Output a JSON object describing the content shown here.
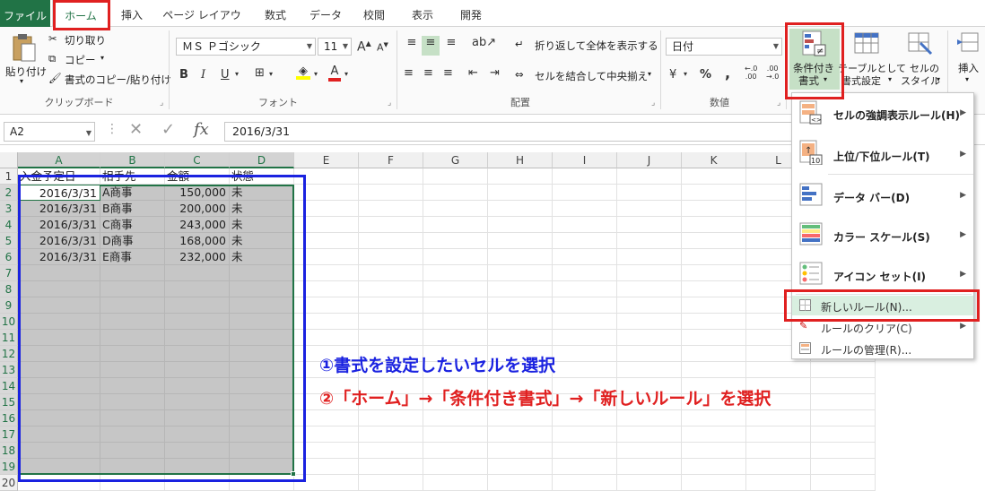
{
  "tabs": [
    "ファイル",
    "ホーム",
    "挿入",
    "ページ レイアウト",
    "数式",
    "データ",
    "校閲",
    "表示",
    "開発"
  ],
  "clipboard": {
    "paste": "貼り付け",
    "cut": "切り取り",
    "copy": "コピー",
    "format_painter": "書式のコピー/貼り付け",
    "group": "クリップボード"
  },
  "font": {
    "name": "ＭＳ Ｐゴシック",
    "size": "11",
    "grow": "A",
    "shrink": "A",
    "bold": "B",
    "italic": "I",
    "underline": "U",
    "color_a": "A",
    "group": "フォント"
  },
  "alignment": {
    "wrap": "折り返して全体を表示する",
    "merge": "セルを結合して中央揃え",
    "group": "配置"
  },
  "number": {
    "format": "日付",
    "currency": "¥",
    "percent": "%",
    "comma": ",",
    "inc_decimal": "←.0\n.00",
    "dec_decimal": ".00\n→.0",
    "group": "数値"
  },
  "styles": {
    "conditional": "条件付き\n書式",
    "conditional_line1": "条件付き",
    "conditional_line2": "書式",
    "table_line1": "テーブルとして",
    "table_line2": "書式設定",
    "cell_line1": "セルの",
    "cell_line2": "スタイル"
  },
  "cells_group": {
    "insert": "挿入"
  },
  "formula_bar": {
    "name_box": "A2",
    "cancel": "✕",
    "enter": "✓",
    "fx": "fx",
    "value": "2016/3/31"
  },
  "columns": [
    "A",
    "B",
    "C",
    "D",
    "E",
    "F",
    "G",
    "H",
    "I",
    "J",
    "K",
    "L",
    "D"
  ],
  "rows": [
    "1",
    "2",
    "3",
    "4",
    "5",
    "6",
    "7",
    "8",
    "9",
    "10",
    "11",
    "12",
    "13",
    "14",
    "15",
    "16",
    "17",
    "18",
    "19",
    "20"
  ],
  "headers": [
    "入金予定日",
    "相手先",
    "金額",
    "状態"
  ],
  "table": [
    [
      "2016/3/31",
      "A商事",
      "150,000",
      "未"
    ],
    [
      "2016/3/31",
      "B商事",
      "200,000",
      "未"
    ],
    [
      "2016/3/31",
      "C商事",
      "243,000",
      "未"
    ],
    [
      "2016/3/31",
      "D商事",
      "168,000",
      "未"
    ],
    [
      "2016/3/31",
      "E商事",
      "232,000",
      "未"
    ]
  ],
  "menu": {
    "highlight": "セルの強調表示ルール(H)",
    "topbottom": "上位/下位ルール(T)",
    "databar": "データ バー(D)",
    "colorscale": "カラー スケール(S)",
    "iconset": "アイコン セット(I)",
    "new_rule": "新しいルール(N)...",
    "clear_rules": "ルールのクリア(C)",
    "manage_rules": "ルールの管理(R)..."
  },
  "annotations": {
    "step1": "①書式を設定したいセルを選択",
    "step2": "②「ホーム」→「条件付き書式」→「新しいルール」を選択"
  },
  "colors": {
    "excel_green": "#217346",
    "highlight_red": "#e02020",
    "annotation_blue": "#1a22e0",
    "selection_gray": "#c6c6c6"
  }
}
